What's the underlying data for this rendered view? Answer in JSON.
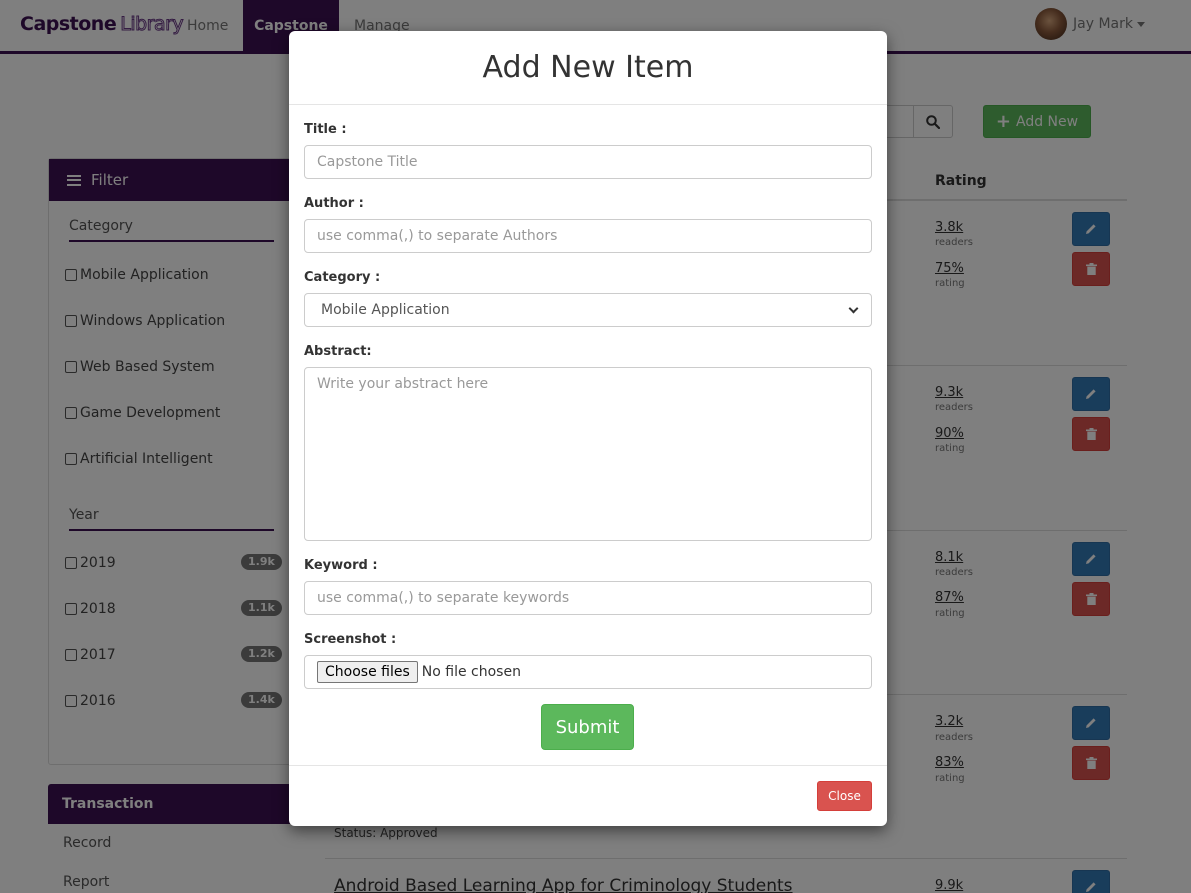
{
  "navbar": {
    "brand_primary": "Capstone",
    "brand_secondary": "Library",
    "links": [
      "Home",
      "Capstone",
      "Manage"
    ],
    "user_name": "Jay Mark"
  },
  "toolbar": {
    "add_new_label": "Add New"
  },
  "filter": {
    "title": "Filter",
    "category_title": "Category",
    "categories": [
      "Mobile Application",
      "Windows Application",
      "Web Based System",
      "Game Development",
      "Artificial Intelligent"
    ],
    "year_title": "Year",
    "years": [
      {
        "label": "2019",
        "count": "1.9k"
      },
      {
        "label": "2018",
        "count": "1.1k"
      },
      {
        "label": "2017",
        "count": "1.2k"
      },
      {
        "label": "2016",
        "count": "1.4k"
      }
    ]
  },
  "transaction": {
    "title": "Transaction",
    "links": [
      "Record",
      "Report"
    ]
  },
  "table": {
    "rating_header": "Rating",
    "rows": [
      {
        "readers": "3.8k",
        "readers_caption": "readers",
        "rating": "75%",
        "rating_caption": "rating"
      },
      {
        "readers": "9.3k",
        "readers_caption": "readers",
        "rating": "90%",
        "rating_caption": "rating"
      },
      {
        "readers": "8.1k",
        "readers_caption": "readers",
        "rating": "87%",
        "rating_caption": "rating"
      },
      {
        "readers": "3.2k",
        "readers_caption": "readers",
        "rating": "83%",
        "rating_caption": "rating"
      },
      {
        "readers": "9.9k"
      }
    ],
    "status_text": "Status: Approved",
    "last_row_title": "Android Based Learning App for Criminology Students"
  },
  "modal": {
    "title": "Add New Item",
    "fields": {
      "title_label": "Title :",
      "title_placeholder": "Capstone Title",
      "author_label": "Author :",
      "author_placeholder": "use comma(,) to separate Authors",
      "category_label": "Category :",
      "category_selected": "Mobile Application",
      "abstract_label": "Abstract:",
      "abstract_placeholder": "Write your abstract here",
      "keyword_label": "Keyword :",
      "keyword_placeholder": "use comma(,) to separate keywords",
      "screenshot_label": "Screenshot :",
      "choose_files_label": "Choose files",
      "no_file_text": "No file chosen"
    },
    "submit_label": "Submit",
    "close_label": "Close"
  },
  "colors": {
    "brand_purple": "#3d1052",
    "success_green": "#5cb85c",
    "primary_blue": "#337ab7",
    "danger_red": "#d9534f"
  }
}
